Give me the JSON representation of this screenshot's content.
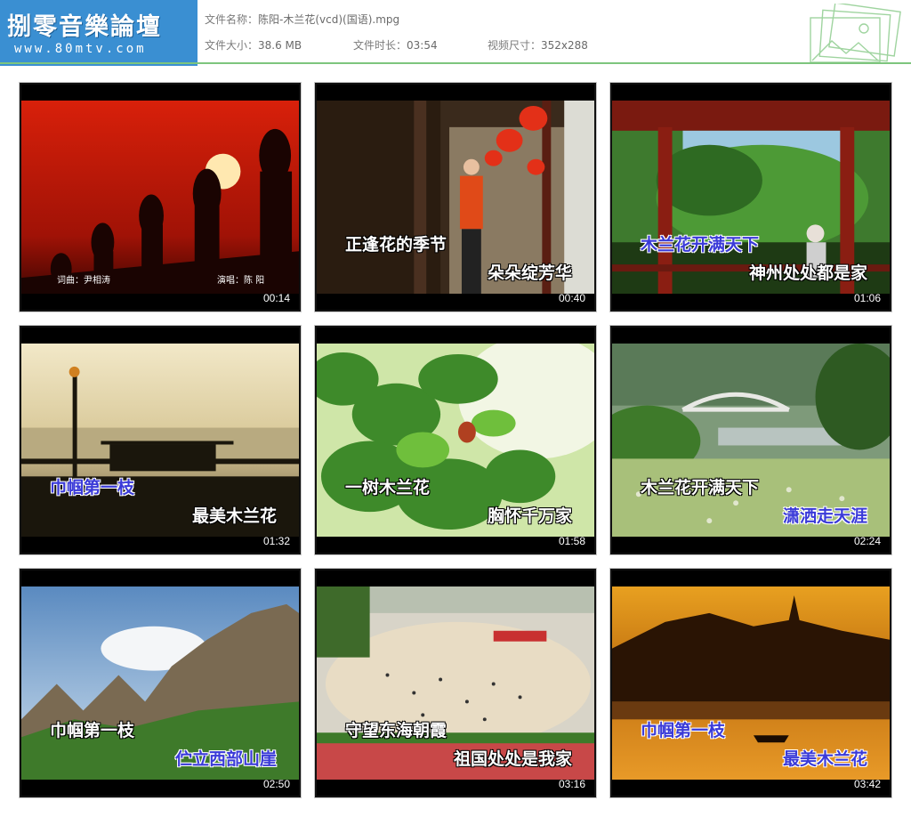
{
  "header": {
    "logo_title": "捌零音樂論壇",
    "logo_url": "www.80mtv.com",
    "file_name_label": "文件名称：",
    "file_name": "陈阳-木兰花(vcd)(国语).mpg",
    "file_size_label": "文件大小：",
    "file_size": "38.6 MB",
    "duration_label": "文件时长：",
    "duration": "03:54",
    "video_size_label": "视频尺寸：",
    "video_size": "352x288",
    "decoration_icon": "photo-stack-icon",
    "divider_color": "#7dc57d",
    "logo_bg_color": "#3a8fd2"
  },
  "thumbnails": [
    {
      "time": "00:14",
      "credits": {
        "lyricist": "词曲：尹相涛",
        "singer": "演唱：陈 阳"
      },
      "scene": "sunset-silhouette"
    },
    {
      "time": "00:40",
      "lyrics": [
        "正逢花的季节",
        "朵朵绽芳华"
      ],
      "scene": "courtyard-lanterns"
    },
    {
      "time": "01:06",
      "lyrics": [
        "木兰花开满天下",
        "神州处处都是家"
      ],
      "scene": "pavilion-garden"
    },
    {
      "time": "01:32",
      "lyrics": [
        "巾帼第一枝",
        "最美木兰花"
      ],
      "scene": "lakeside-dawn"
    },
    {
      "time": "01:58",
      "lyrics": [
        "一树木兰花",
        "胸怀千万家"
      ],
      "scene": "green-leaves"
    },
    {
      "time": "02:24",
      "lyrics": [
        "木兰花开满天下",
        "潇洒走天涯"
      ],
      "scene": "bridge-flowers"
    },
    {
      "time": "02:50",
      "lyrics": [
        "巾帼第一枝",
        "伫立西部山崖"
      ],
      "scene": "mountain-cliffs"
    },
    {
      "time": "03:16",
      "lyrics": [
        "守望东海朝霞",
        "祖国处处是我家"
      ],
      "scene": "city-square"
    },
    {
      "time": "03:42",
      "lyrics": [
        "巾帼第一枝",
        "最美木兰花"
      ],
      "scene": "golden-lake"
    }
  ]
}
